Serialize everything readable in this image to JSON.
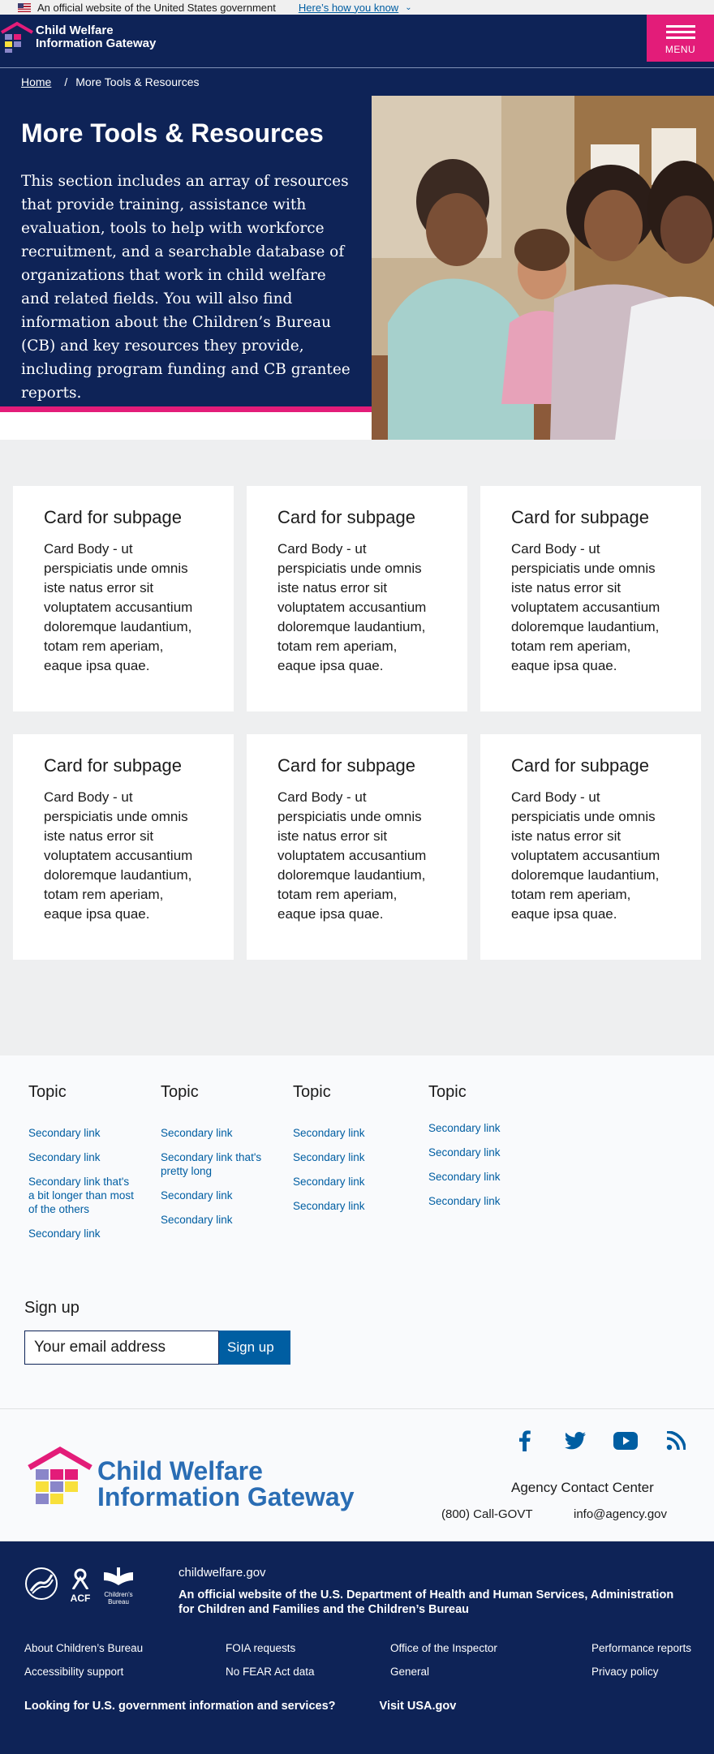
{
  "gov_banner": {
    "official_text": "An official website of the United States government",
    "how_link": "Here’s how you know"
  },
  "header": {
    "logo_line1": "Child Welfare",
    "logo_line2": "Information Gateway",
    "menu_label": "MENU"
  },
  "breadcrumb": {
    "home": "Home",
    "current": "More Tools & Resources"
  },
  "hero": {
    "title": "More Tools & Resources",
    "body": "This section includes an array of resources that provide training, assistance with evaluation, tools to help with workforce recruitment, and a searchable database of organizations that work in child welfare and related fields. You will also find information about the Children’s Bureau (CB) and key resources they provide, including program funding and CB grantee reports."
  },
  "cards": [
    {
      "title": "Card for subpage",
      "body": "Card Body - ut perspiciatis unde omnis iste natus error sit voluptatem accusantium doloremque laudantium, totam rem aperiam, eaque ipsa quae."
    },
    {
      "title": "Card for subpage",
      "body": "Card Body - ut perspiciatis unde omnis iste natus error sit voluptatem accusantium doloremque laudantium, totam rem aperiam, eaque ipsa quae."
    },
    {
      "title": "Card for subpage",
      "body": "Card Body - ut perspiciatis unde omnis iste natus error sit voluptatem accusantium doloremque laudantium, totam rem aperiam, eaque ipsa quae."
    },
    {
      "title": "Card for subpage",
      "body": "Card Body - ut perspiciatis unde omnis iste natus error sit voluptatem accusantium doloremque laudantium, totam rem aperiam, eaque ipsa quae."
    },
    {
      "title": "Card for subpage",
      "body": "Card Body - ut perspiciatis unde omnis iste natus error sit voluptatem accusantium doloremque laudantium, totam rem aperiam, eaque ipsa quae."
    },
    {
      "title": "Card for subpage",
      "body": "Card Body - ut perspiciatis unde omnis iste natus error sit voluptatem accusantium doloremque laudantium, totam rem aperiam, eaque ipsa quae."
    }
  ],
  "topics": [
    {
      "title": "Topic",
      "links": [
        "Secondary link",
        "Secondary link",
        "Secondary link that's a bit longer than most of the others",
        "Secondary link"
      ]
    },
    {
      "title": "Topic",
      "links": [
        "Secondary link",
        "Secondary link that's pretty long",
        "Secondary link",
        "Secondary link"
      ]
    },
    {
      "title": "Topic",
      "links": [
        "Secondary link",
        "Secondary link",
        "Secondary link",
        "Secondary link"
      ]
    },
    {
      "title": "Topic",
      "links": [
        "Secondary link",
        "Secondary link",
        "Secondary link",
        "Secondary link"
      ]
    }
  ],
  "signup": {
    "heading": "Sign up",
    "placeholder": "Your email address",
    "button": "Sign up"
  },
  "footer": {
    "logo_line1": "Child Welfare",
    "logo_line2": "Information Gateway",
    "social": [
      "facebook-icon",
      "twitter-icon",
      "youtube-icon",
      "rss-icon"
    ],
    "contact_heading": "Agency Contact Center",
    "phone": "(800) Call-GOVT",
    "email": "info@agency.gov"
  },
  "identifier": {
    "domain": "childwelfare.gov",
    "official": "An official website of the U.S. Department of Health and Human Services, Administration for Children and Families and the Children’s Bureau",
    "acf_label": "ACF",
    "cb_label_1": "Children's",
    "cb_label_2": "Bureau",
    "links": [
      "About Children’s Bureau",
      "FOIA requests",
      "Office of the Inspector",
      "Performance reports",
      "Accessibility support",
      "No FEAR Act data",
      "General",
      "Privacy policy"
    ],
    "usa_text": "Looking for U.S. government information and services?",
    "usa_link": "Visit USA.gov"
  },
  "colors": {
    "navy": "#0e2357",
    "pink": "#e31c79",
    "link_blue": "#005ea2",
    "logo_blue": "#2a6db4"
  }
}
